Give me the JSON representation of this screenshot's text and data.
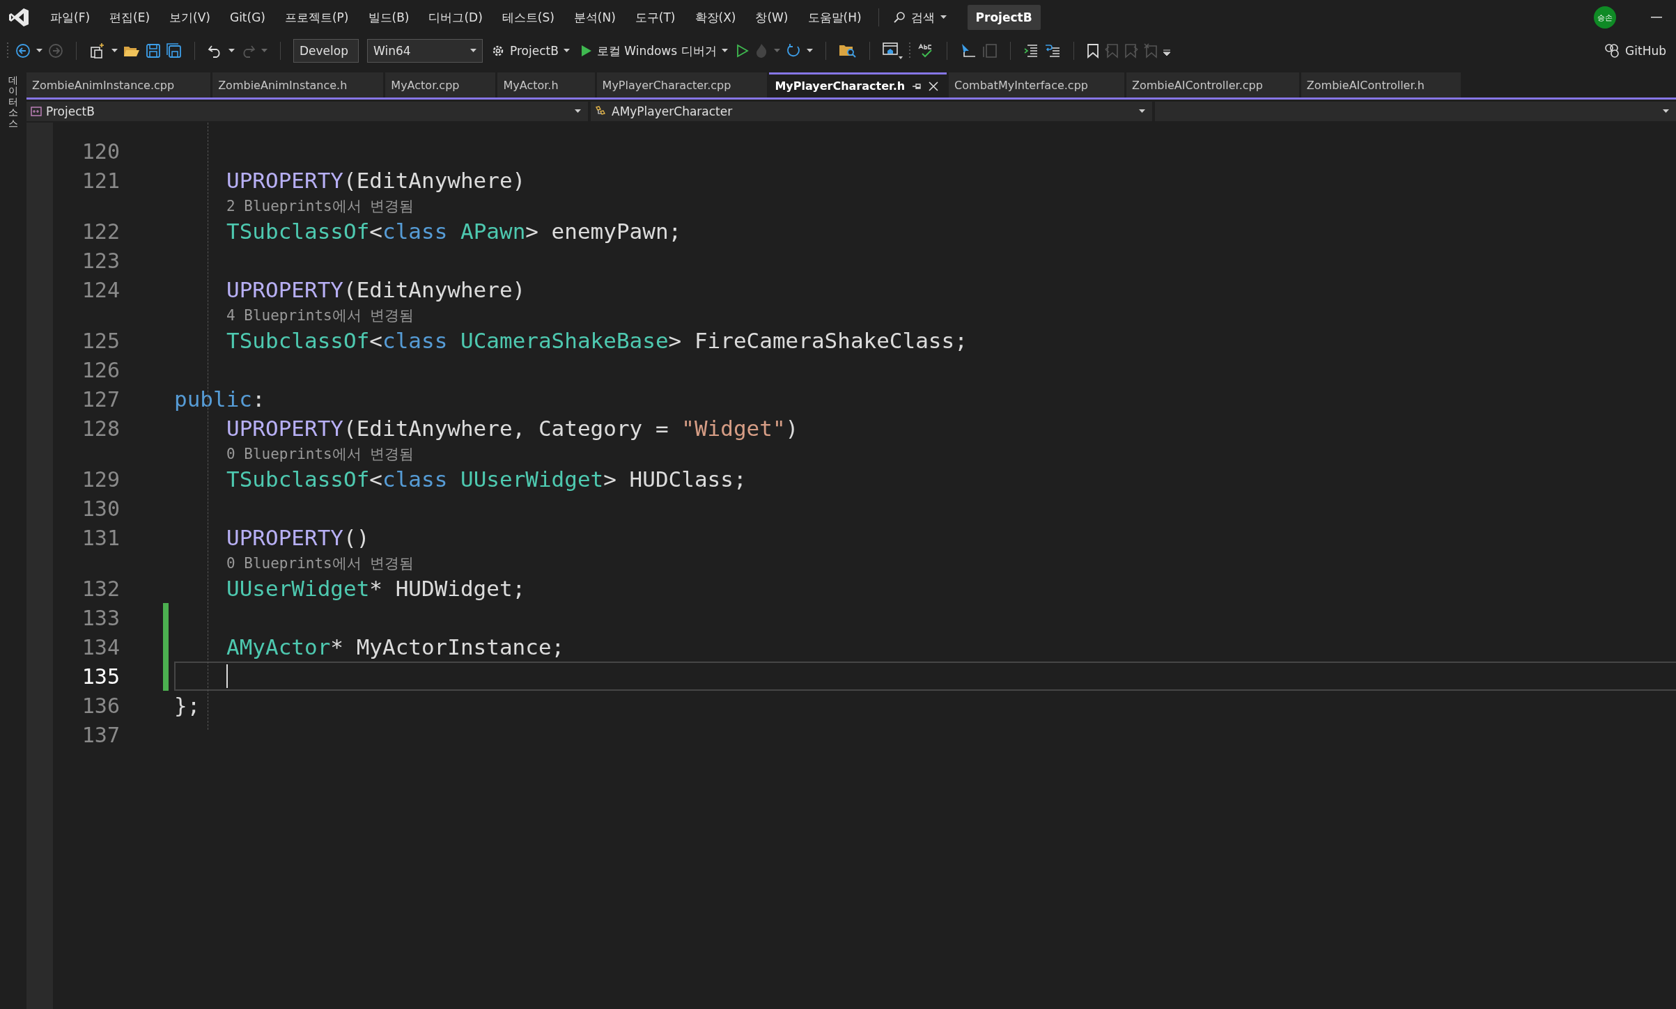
{
  "menu": [
    "파일(F)",
    "편집(E)",
    "보기(V)",
    "Git(G)",
    "프로젝트(P)",
    "빌드(B)",
    "디버그(D)",
    "테스트(S)",
    "분석(N)",
    "도구(T)",
    "확장(X)",
    "창(W)",
    "도움말(H)"
  ],
  "search": {
    "label": "검색"
  },
  "window": {
    "title": "ProjectB"
  },
  "account": {
    "initials": "승손"
  },
  "toolbar": {
    "configuration": "Develop",
    "platform": "Win64",
    "startup_project": "ProjectB",
    "debugger": "로컬 Windows 디버거",
    "github": "GitHub"
  },
  "side_panel": {
    "label": "데이터 소스"
  },
  "tabs": [
    {
      "label": "ZombieAnimInstance.cpp",
      "selected": false
    },
    {
      "label": "ZombieAnimInstance.h",
      "selected": false
    },
    {
      "label": "MyActor.cpp",
      "selected": false
    },
    {
      "label": "MyActor.h",
      "selected": false
    },
    {
      "label": "MyPlayerCharacter.cpp",
      "selected": false
    },
    {
      "label": "MyPlayerCharacter.h",
      "selected": true
    },
    {
      "label": "CombatMyInterface.cpp",
      "selected": false
    },
    {
      "label": "ZombieAIController.cpp",
      "selected": false
    },
    {
      "label": "ZombieAIController.h",
      "selected": false
    }
  ],
  "navigation": {
    "project": "ProjectB",
    "scope": "AMyPlayerCharacter"
  },
  "code": [
    {
      "number": "120",
      "changed": false,
      "current": false
    },
    {
      "number": "121",
      "indent": true,
      "tokens": [
        {
          "kind": "macro",
          "text": "UPROPERTY"
        },
        {
          "kind": "plain",
          "text": "(EditAnywhere)"
        }
      ],
      "changed": false,
      "current": false,
      "lens": "2 Blueprints에서 변경됨"
    },
    {
      "number": "122",
      "indent": true,
      "tokens": [
        {
          "kind": "type",
          "text": "TSubclassOf"
        },
        {
          "kind": "plain",
          "text": "<"
        },
        {
          "kind": "keyword",
          "text": "class"
        },
        {
          "kind": "type",
          "text": " APawn"
        },
        {
          "kind": "plain",
          "text": "> enemyPawn;"
        }
      ],
      "changed": false,
      "current": false
    },
    {
      "number": "123",
      "changed": false,
      "current": false
    },
    {
      "number": "124",
      "indent": true,
      "tokens": [
        {
          "kind": "macro",
          "text": "UPROPERTY"
        },
        {
          "kind": "plain",
          "text": "(EditAnywhere)"
        }
      ],
      "changed": false,
      "current": false,
      "lens": "4 Blueprints에서 변경됨"
    },
    {
      "number": "125",
      "indent": true,
      "tokens": [
        {
          "kind": "type",
          "text": "TSubclassOf"
        },
        {
          "kind": "plain",
          "text": "<"
        },
        {
          "kind": "keyword",
          "text": "class"
        },
        {
          "kind": "type",
          "text": " UCameraShakeBase"
        },
        {
          "kind": "plain",
          "text": "> FireCameraShakeClass;"
        }
      ],
      "changed": false,
      "current": false
    },
    {
      "number": "126",
      "changed": false,
      "current": false
    },
    {
      "number": "127",
      "indent": false,
      "tokens": [
        {
          "kind": "keyword",
          "text": "public"
        },
        {
          "kind": "plain",
          "text": ":"
        }
      ],
      "changed": false,
      "current": false
    },
    {
      "number": "128",
      "indent": true,
      "tokens": [
        {
          "kind": "macro",
          "text": "UPROPERTY"
        },
        {
          "kind": "plain",
          "text": "(EditAnywhere, Category = "
        },
        {
          "kind": "string",
          "text": "\"Widget\""
        },
        {
          "kind": "plain",
          "text": ")"
        }
      ],
      "changed": false,
      "current": false,
      "lens": "0 Blueprints에서 변경됨"
    },
    {
      "number": "129",
      "indent": true,
      "tokens": [
        {
          "kind": "type",
          "text": "TSubclassOf"
        },
        {
          "kind": "plain",
          "text": "<"
        },
        {
          "kind": "keyword",
          "text": "class"
        },
        {
          "kind": "type",
          "text": " UUserWidget"
        },
        {
          "kind": "plain",
          "text": "> HUDClass;"
        }
      ],
      "changed": false,
      "current": false
    },
    {
      "number": "130",
      "changed": false,
      "current": false
    },
    {
      "number": "131",
      "indent": true,
      "tokens": [
        {
          "kind": "macro",
          "text": "UPROPERTY"
        },
        {
          "kind": "plain",
          "text": "()"
        }
      ],
      "changed": false,
      "current": false,
      "lens": "0 Blueprints에서 변경됨"
    },
    {
      "number": "132",
      "indent": true,
      "tokens": [
        {
          "kind": "type",
          "text": "UUserWidget"
        },
        {
          "kind": "plain",
          "text": "* HUDWidget;"
        }
      ],
      "changed": false,
      "current": false
    },
    {
      "number": "133",
      "changed": true,
      "current": false
    },
    {
      "number": "134",
      "indent": true,
      "tokens": [
        {
          "kind": "type",
          "text": "AMyActor"
        },
        {
          "kind": "plain",
          "text": "* MyActorInstance;"
        }
      ],
      "changed": true,
      "current": false
    },
    {
      "number": "135",
      "changed": true,
      "current": true
    },
    {
      "number": "136",
      "indent": false,
      "tokens": [
        {
          "kind": "plain",
          "text": "};"
        }
      ],
      "changed": false,
      "current": false
    },
    {
      "number": "137",
      "changed": false,
      "current": false
    }
  ]
}
